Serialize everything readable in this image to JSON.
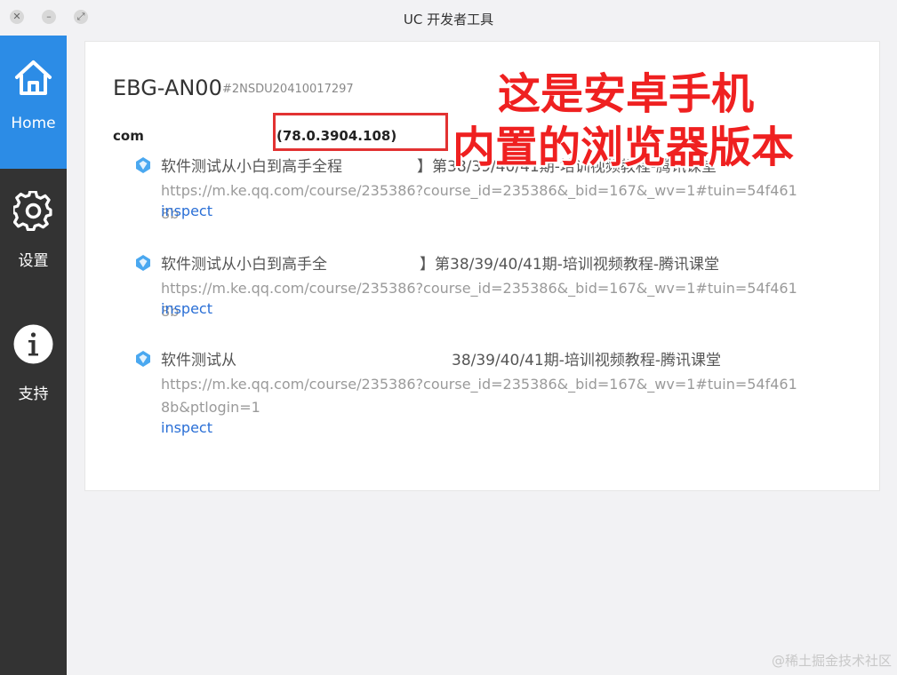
{
  "window": {
    "title": "UC 开发者工具"
  },
  "sidebar": {
    "items": [
      {
        "label": "Home",
        "icon": "home-icon",
        "active": true
      },
      {
        "label": "设置",
        "icon": "gear-icon",
        "active": false
      },
      {
        "label": "支持",
        "icon": "info-icon",
        "active": false
      }
    ]
  },
  "device": {
    "name": "EBG-AN00",
    "serial": "#2NSDU20410017297",
    "browser_prefix": "com",
    "browser_version": "(78.0.3904.108)"
  },
  "tabs": [
    {
      "title": "软件测试从小白到高手全程",
      "title_tail": "】第38/39/40/41期-培训视频教程-腾讯课堂",
      "url": "https://m.ke.qq.com/course/235386?course_id=235386&_bid=167&_wv=1#tuin=54f4618b",
      "action": "inspect"
    },
    {
      "title": "软件测试从小白到高手全",
      "title_tail": "】第38/39/40/41期-培训视频教程-腾讯课堂",
      "url": "https://m.ke.qq.com/course/235386?course_id=235386&_bid=167&_wv=1#tuin=54f4618b",
      "action": "inspect"
    },
    {
      "title": "软件测试从",
      "title_tail": "38/39/40/41期-培训视频教程-腾讯课堂",
      "url": "https://m.ke.qq.com/course/235386?course_id=235386&_bid=167&_wv=1#tuin=54f4618b&ptlogin=1",
      "action": "inspect"
    }
  ],
  "annotation": {
    "line1": "这是安卓手机",
    "line2": "内置的浏览器版本",
    "color": "#ef2020"
  },
  "watermark": "@稀土掘金技术社区",
  "colors": {
    "sidebar_bg": "#333333",
    "active_nav": "#2c8ce6",
    "link": "#2a6fd6",
    "highlight": "#e23232"
  }
}
